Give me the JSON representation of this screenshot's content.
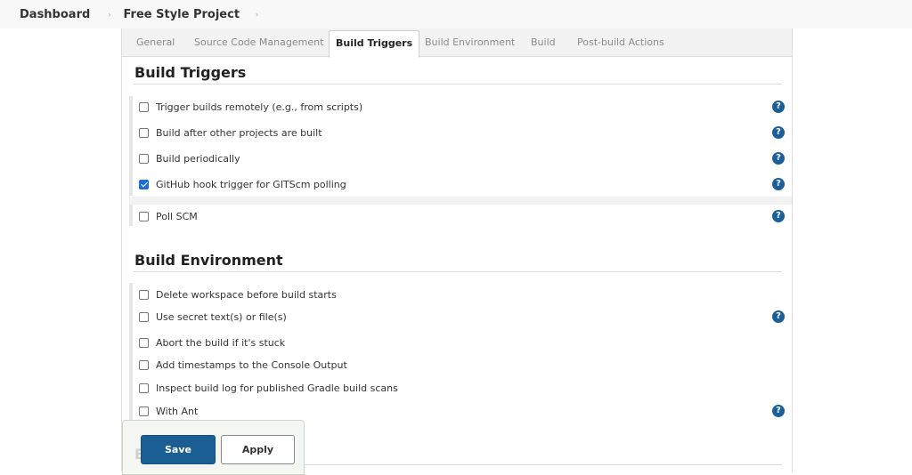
{
  "breadcrumb": {
    "items": [
      "Dashboard",
      "Free Style Project"
    ],
    "separator": "›"
  },
  "tabs": [
    {
      "label": "General",
      "active": false
    },
    {
      "label": "Source Code Management",
      "active": false
    },
    {
      "label": "Build Triggers",
      "active": true
    },
    {
      "label": "Build Environment",
      "active": false
    },
    {
      "label": "Build",
      "active": false
    },
    {
      "label": "Post-build Actions",
      "active": false
    }
  ],
  "build_triggers": {
    "title": "Build Triggers",
    "options": [
      {
        "label": "Trigger builds remotely (e.g., from scripts)",
        "checked": false,
        "help": true
      },
      {
        "label": "Build after other projects are built",
        "checked": false,
        "help": true
      },
      {
        "label": "Build periodically",
        "checked": false,
        "help": true
      },
      {
        "label": "GitHub hook trigger for GITScm polling",
        "checked": true,
        "help": true
      },
      {
        "label": "Poll SCM",
        "checked": false,
        "help": true
      }
    ]
  },
  "build_environment": {
    "title": "Build Environment",
    "options": [
      {
        "label": "Delete workspace before build starts",
        "checked": false,
        "help": false
      },
      {
        "label": "Use secret text(s) or file(s)",
        "checked": false,
        "help": true
      },
      {
        "label": "Abort the build if it's stuck",
        "checked": false,
        "help": false
      },
      {
        "label": "Add timestamps to the Console Output",
        "checked": false,
        "help": false
      },
      {
        "label": "Inspect build log for published Gradle build scans",
        "checked": false,
        "help": false
      },
      {
        "label": "With Ant",
        "checked": false,
        "help": true
      }
    ]
  },
  "help_glyph": "?",
  "next_section_fragment": "B",
  "actions": {
    "save_label": "Save",
    "apply_label": "Apply"
  },
  "colors": {
    "primary": "#1b5e94",
    "checkbox_checked": "#1c6ed4",
    "help_icon": "#1a5f9a"
  }
}
